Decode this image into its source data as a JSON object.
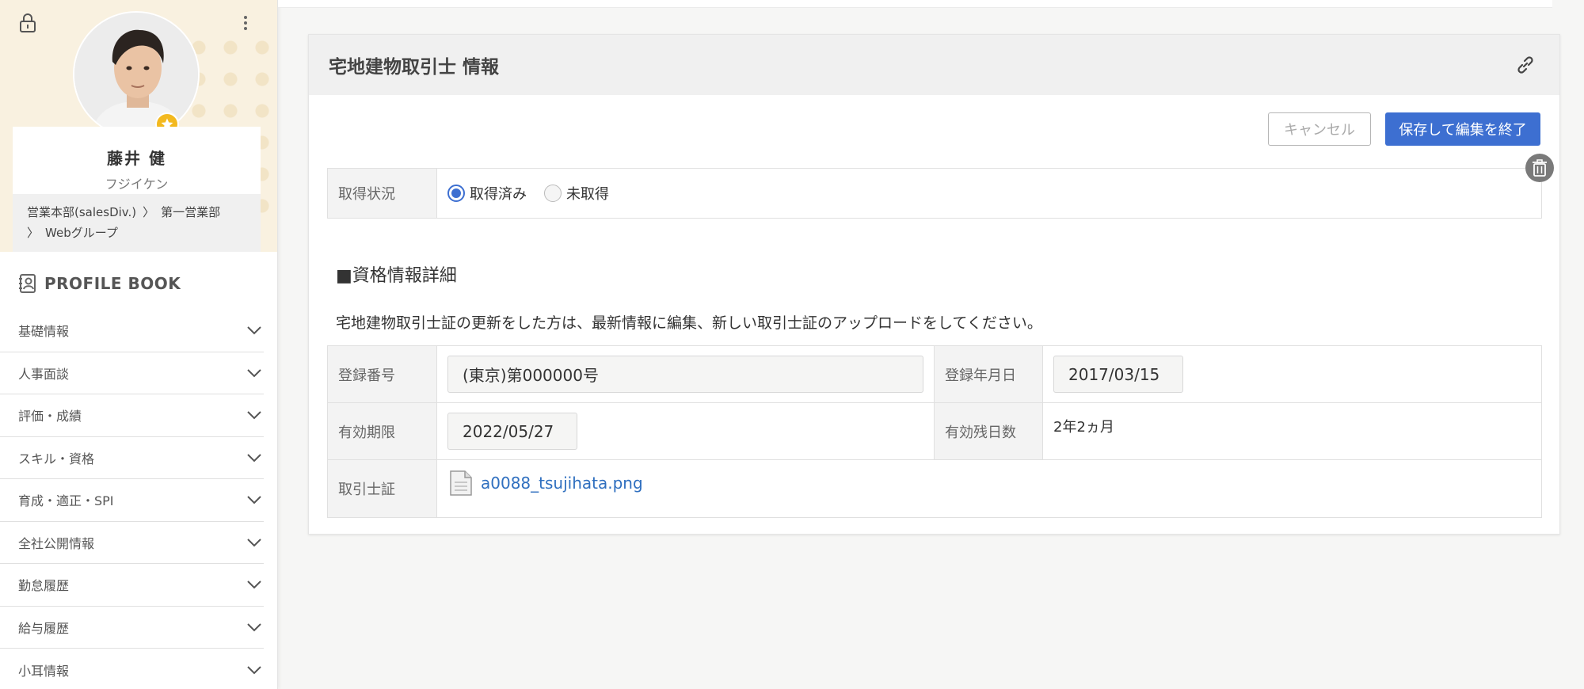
{
  "sidebar": {
    "profile": {
      "name": "藤井 健",
      "kana": "フジイケン",
      "dept_1": "営業本部(salesDiv.)",
      "dept_2": "第一営業部",
      "dept_3": "Webグループ"
    },
    "book_title": "PROFILE BOOK",
    "menu": [
      "基礎情報",
      "人事面談",
      "評価・成績",
      "スキル・資格",
      "育成・適正・SPI",
      "全社公開情報",
      "勤怠履歴",
      "給与履歴",
      "小耳情報"
    ]
  },
  "card": {
    "title": "宅地建物取引士 情報",
    "cancel_label": "キャンセル",
    "save_label": "保存して編集を終了",
    "status_label": "取得状況",
    "status_options": [
      "取得済み",
      "未取得"
    ],
    "status_selected": "取得済み",
    "section_title": "■資格情報詳細",
    "note": "宅地建物取引士証の更新をした方は、最新情報に編集、新しい取引士証のアップロードをしてください。",
    "fields": {
      "reg_no_label": "登録番号",
      "reg_no_value": "(東京)第000000号",
      "reg_date_label": "登録年月日",
      "reg_date_value": "2017/03/15",
      "expiry_label": "有効期限",
      "expiry_value": "2022/05/27",
      "remaining_label": "有効残日数",
      "remaining_value": "2年2ヵ月",
      "cert_label": "取引士証",
      "cert_file": "a0088_tsujihata.png"
    }
  },
  "colors": {
    "accent": "#3d6fd1",
    "link": "#2f6fbf",
    "profile_bg": "#f9f1e0",
    "badge": "#f3b91f"
  }
}
